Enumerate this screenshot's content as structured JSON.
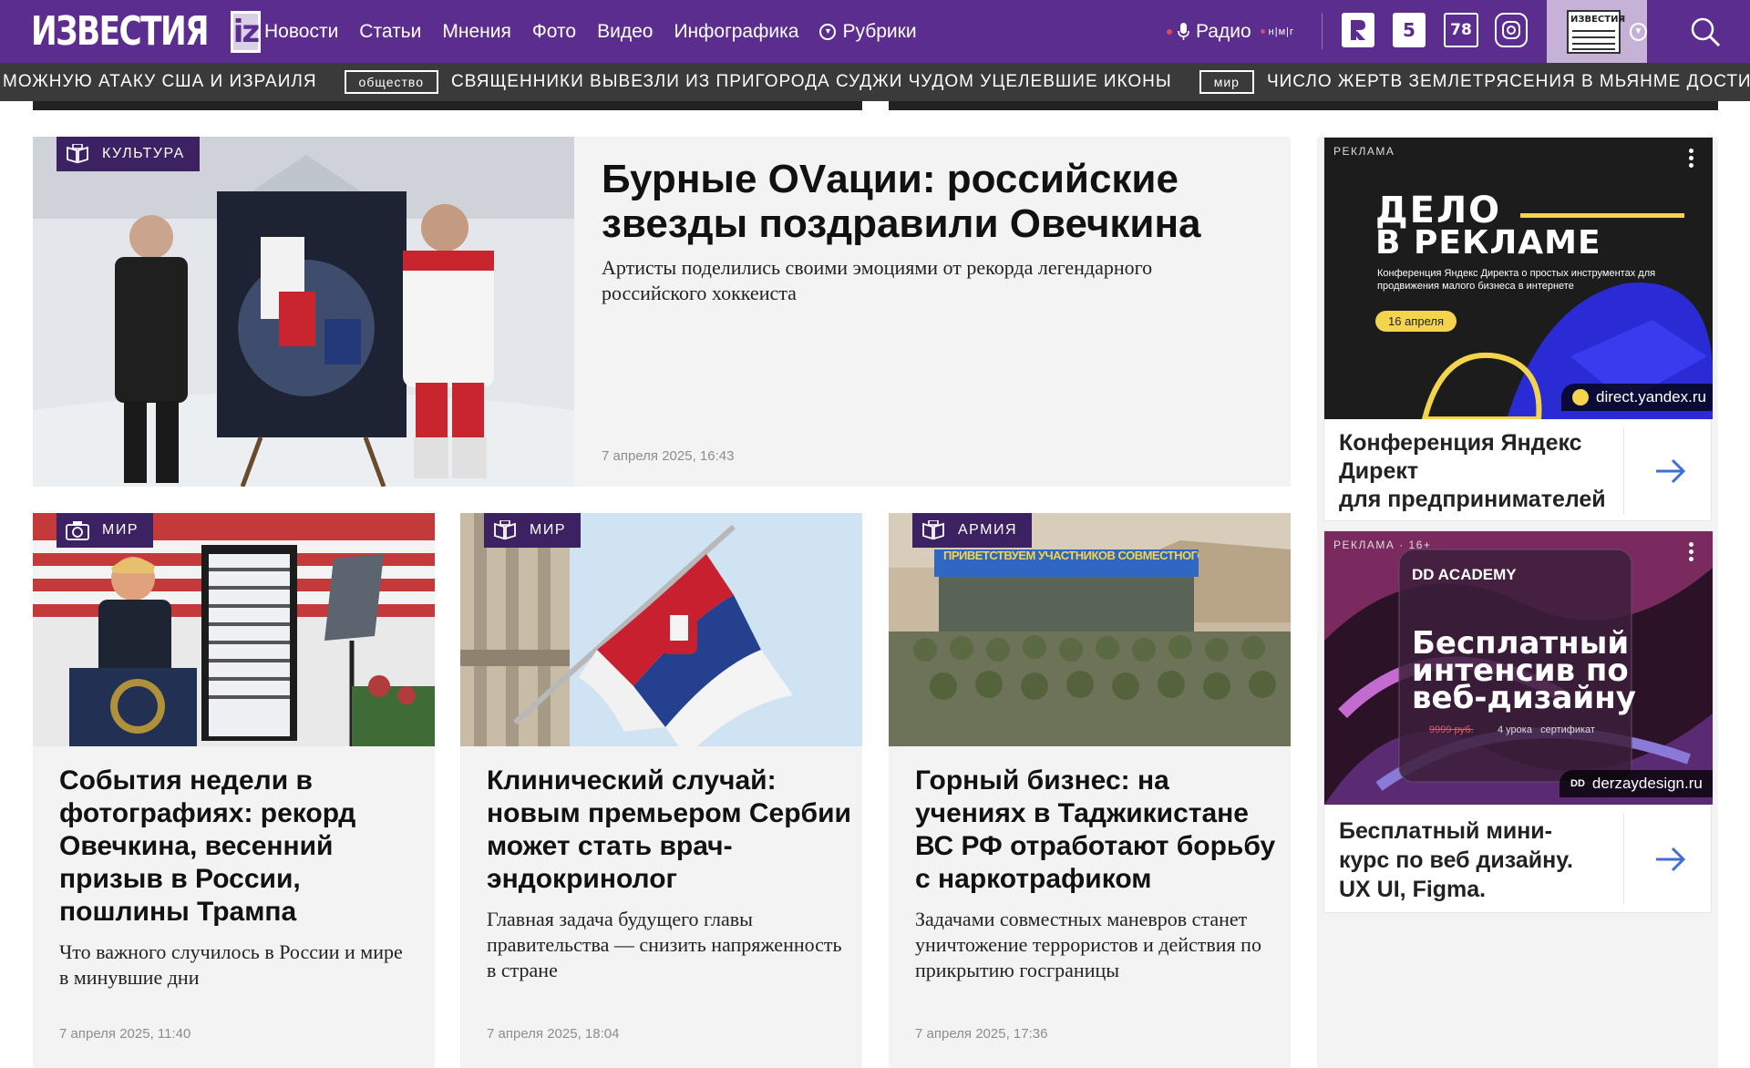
{
  "header": {
    "logo_text": "ИЗВЕСТИЯ",
    "logo_badge": "iz",
    "nav": [
      "Новости",
      "Статьи",
      "Мнения",
      "Фото",
      "Видео",
      "Инфографика"
    ],
    "rubrics_label": "Рубрики",
    "radio_label": "Радио",
    "radio_freq": "н|м|г",
    "channels": [
      "5",
      "78"
    ],
    "newspaper_label": "ИЗВЕСТИЯ"
  },
  "ticker": {
    "items": [
      {
        "text": "можную атаку США и Израиля"
      },
      {
        "tag": "общество",
        "text": "Священники вывезли из пригорода Суджи чудом уцелевшие иконы"
      },
      {
        "tag": "мир",
        "text": "Число жертв землетрясения в Мьянме достигло"
      }
    ]
  },
  "main_article": {
    "rubric": "Культура",
    "title": "Бурные OVации: российские звезды поздравили Овечкина",
    "lead": "Артисты поделились своими эмоциями от рекорда легендарного российского хоккеиста",
    "date": "7 апреля 2025, 16:43"
  },
  "cards": [
    {
      "rubric": "Мир",
      "title": "События недели в фотографиях: рекорд Овечкина, весенний призыв в России, пошлины Трампа",
      "lead": "Что важного случилось в России и мире в минувшие дни",
      "date": "7 апреля 2025, 11:40"
    },
    {
      "rubric": "Мир",
      "title": "Клинический случай: новым премьером Сербии может стать врач-эндокринолог",
      "lead": "Главная задача будущего главы правительства — снизить напряженность в стране",
      "date": "7 апреля 2025, 18:04"
    },
    {
      "rubric": "Армия",
      "title": "Горный бизнес: на учениях в Таджикистане ВС РФ отработают борьбу с наркотрафиком",
      "lead": "Задачами совместных маневров станет уничтожение террористов и действия по прикрытию госграницы",
      "date": "7 апреля 2025, 17:36",
      "banner_text": "ПРИВЕТСТВУЕМ УЧАСТНИКОВ СОВМЕСТНОГО УЧЕНИЯ"
    }
  ],
  "ads": [
    {
      "label": "Реклама",
      "promo_line1": "ДЕЛО",
      "promo_line2": "В РЕКЛАМЕ",
      "promo_sub": "Конференция Яндекс Директа о простых инструментах для продвижения малого бизнеса в интернете",
      "promo_date": "16 апреля",
      "domain": "direct.yandex.ru",
      "text_lines": [
        "Конференция Яндекс",
        "Директ",
        "для предпринимателей"
      ]
    },
    {
      "label": "Реклама · 16+",
      "promo_brand": "DD ACADEMY",
      "promo_lines": [
        "Бесплатный",
        "интенсив по",
        "веб-дизайну"
      ],
      "promo_price": "9999 руб.",
      "promo_meta": "4 урока   сертификат",
      "domain": "derzaydesign.ru",
      "text_lines": [
        "Бесплатный мини-",
        "курс по веб дизайну.",
        "UX UI, Figma."
      ]
    }
  ],
  "colors": {
    "brand_purple": "#5b2d8e",
    "rubric_bg": "#3c2263",
    "card_bg": "#f3f3f3",
    "ticker_bg": "#3a3a3a",
    "ad_arrow": "#3d6fd6"
  }
}
